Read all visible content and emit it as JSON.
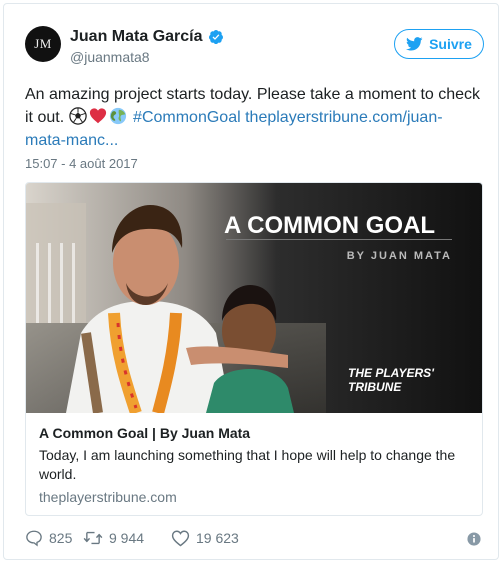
{
  "author": {
    "avatar_initials": "JM",
    "display_name": "Juan Mata García",
    "handle": "@juanmata8",
    "verified": true
  },
  "follow_button": {
    "label": "Suivre",
    "icon": "twitter-bird-icon"
  },
  "tweet": {
    "text_line1": "An amazing project starts today. Please take a moment to check",
    "text_line2_prefix": "it out.",
    "emojis": [
      "soccer-ball-icon",
      "red-heart-icon",
      "globe-icon"
    ],
    "hashtag": "#CommonGoal",
    "link_part1": "theplayerstribune.com/juan-",
    "link_part2": "mata-manc...",
    "timestamp": "15:07 - 4 août 2017"
  },
  "card": {
    "image_headline": "A COMMON GOAL",
    "image_byline": "BY JUAN MATA",
    "image_brand_line1": "THE PLAYERS'",
    "image_brand_line2": "TRIBUNE",
    "title": "A Common Goal | By Juan Mata",
    "description": "Today, I am launching something that I hope will help to change the world.",
    "domain": "theplayerstribune.com"
  },
  "actions": {
    "replies": "825",
    "retweets": "9 944",
    "likes": "19 623"
  },
  "colors": {
    "accent": "#1da1f2",
    "link": "#2b7bb9",
    "muted": "#697882",
    "text": "#1c2022",
    "border": "#e1e8ed"
  }
}
